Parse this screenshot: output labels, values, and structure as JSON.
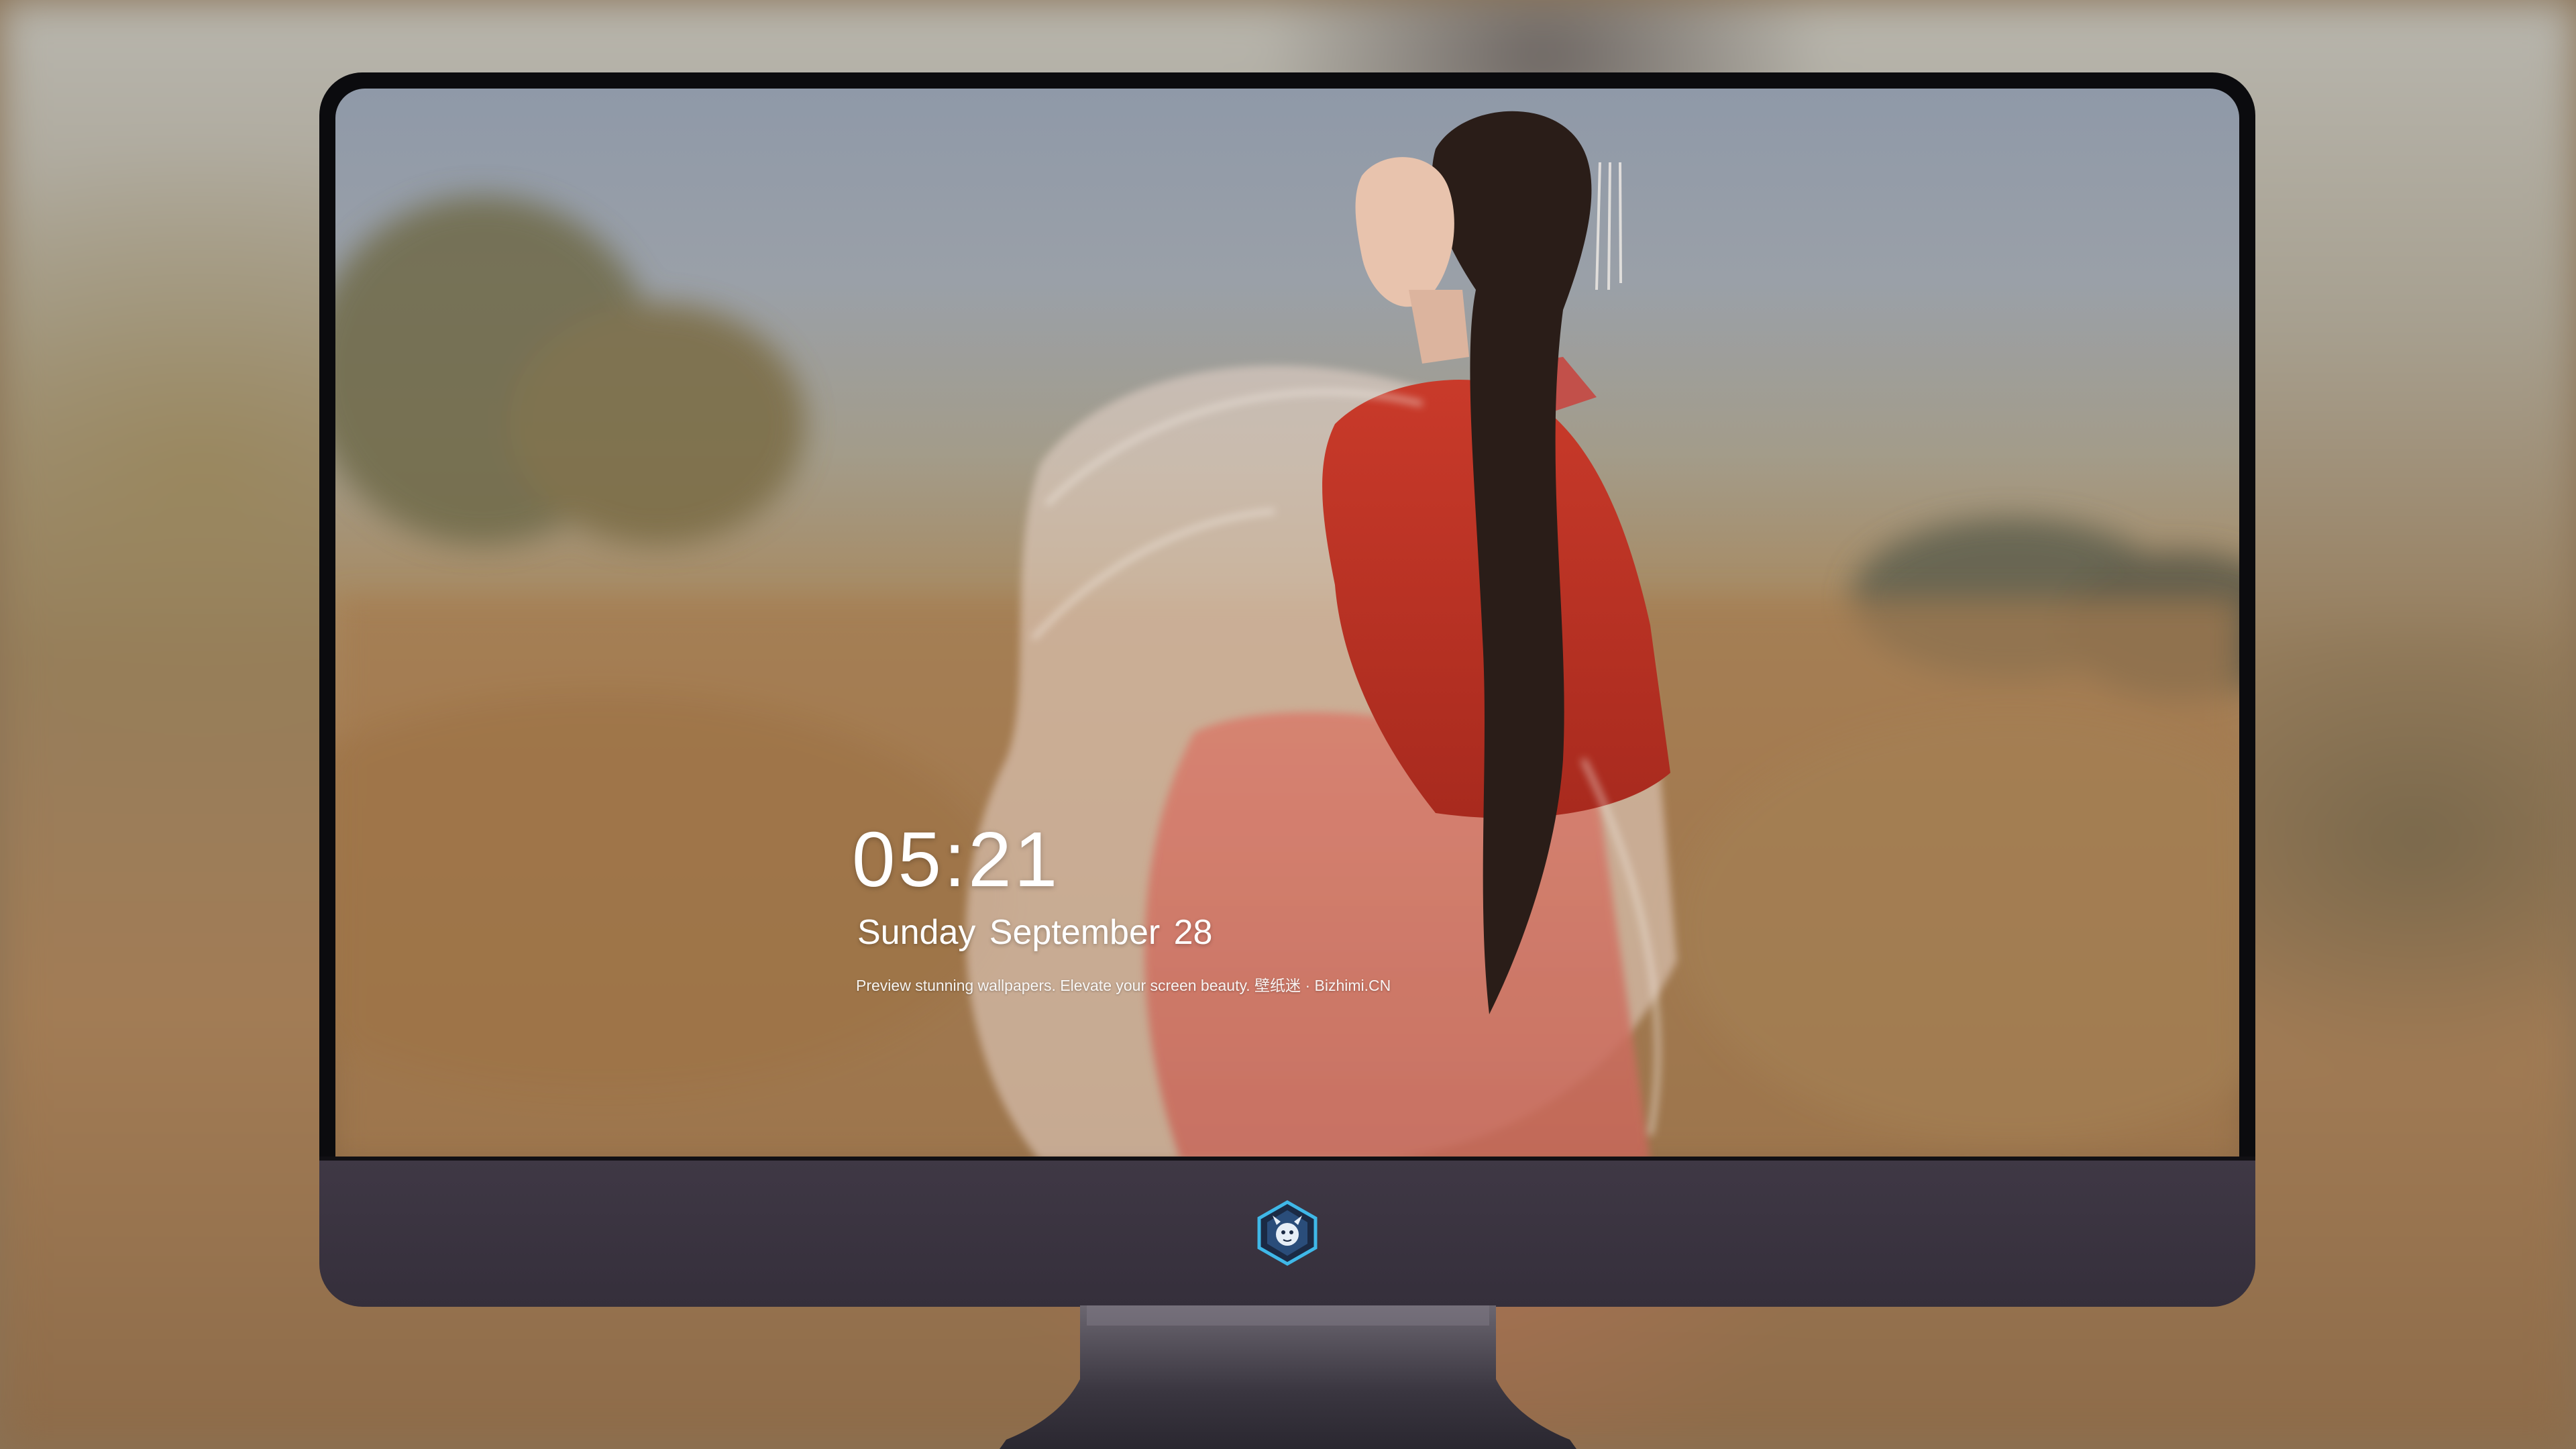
{
  "lockscreen": {
    "time": "05:21",
    "date": "Sunday September  28",
    "tagline": "Preview stunning wallpapers. Elevate your screen beauty. 壁纸迷 · Bizhimi.CN"
  },
  "dock": {
    "apps": [
      {
        "icon": "messages-icon",
        "color": "#34c759"
      },
      {
        "icon": "weather-icon",
        "color": "#1e90ff"
      },
      {
        "icon": "clock-icon",
        "color": "#111111"
      },
      {
        "icon": "maps-icon",
        "color": "#f5c542"
      },
      {
        "icon": "clips-icon",
        "color": "#5ac8fa"
      },
      {
        "icon": "notes-icon",
        "color": "#ffd23f"
      },
      {
        "icon": "photos-icon",
        "color": "#f2f2f2"
      },
      {
        "icon": "music-icon",
        "color": "#d63ce0"
      },
      {
        "icon": "app-store-icon",
        "color": "#1e8bff"
      },
      {
        "icon": "camera-icon",
        "color": "#4a4a4a"
      }
    ]
  },
  "monitor": {
    "bezel_color": "#0b0b0e",
    "chin_color": "#3f3845",
    "logo_icon": "dragon-shield-logo-icon"
  }
}
